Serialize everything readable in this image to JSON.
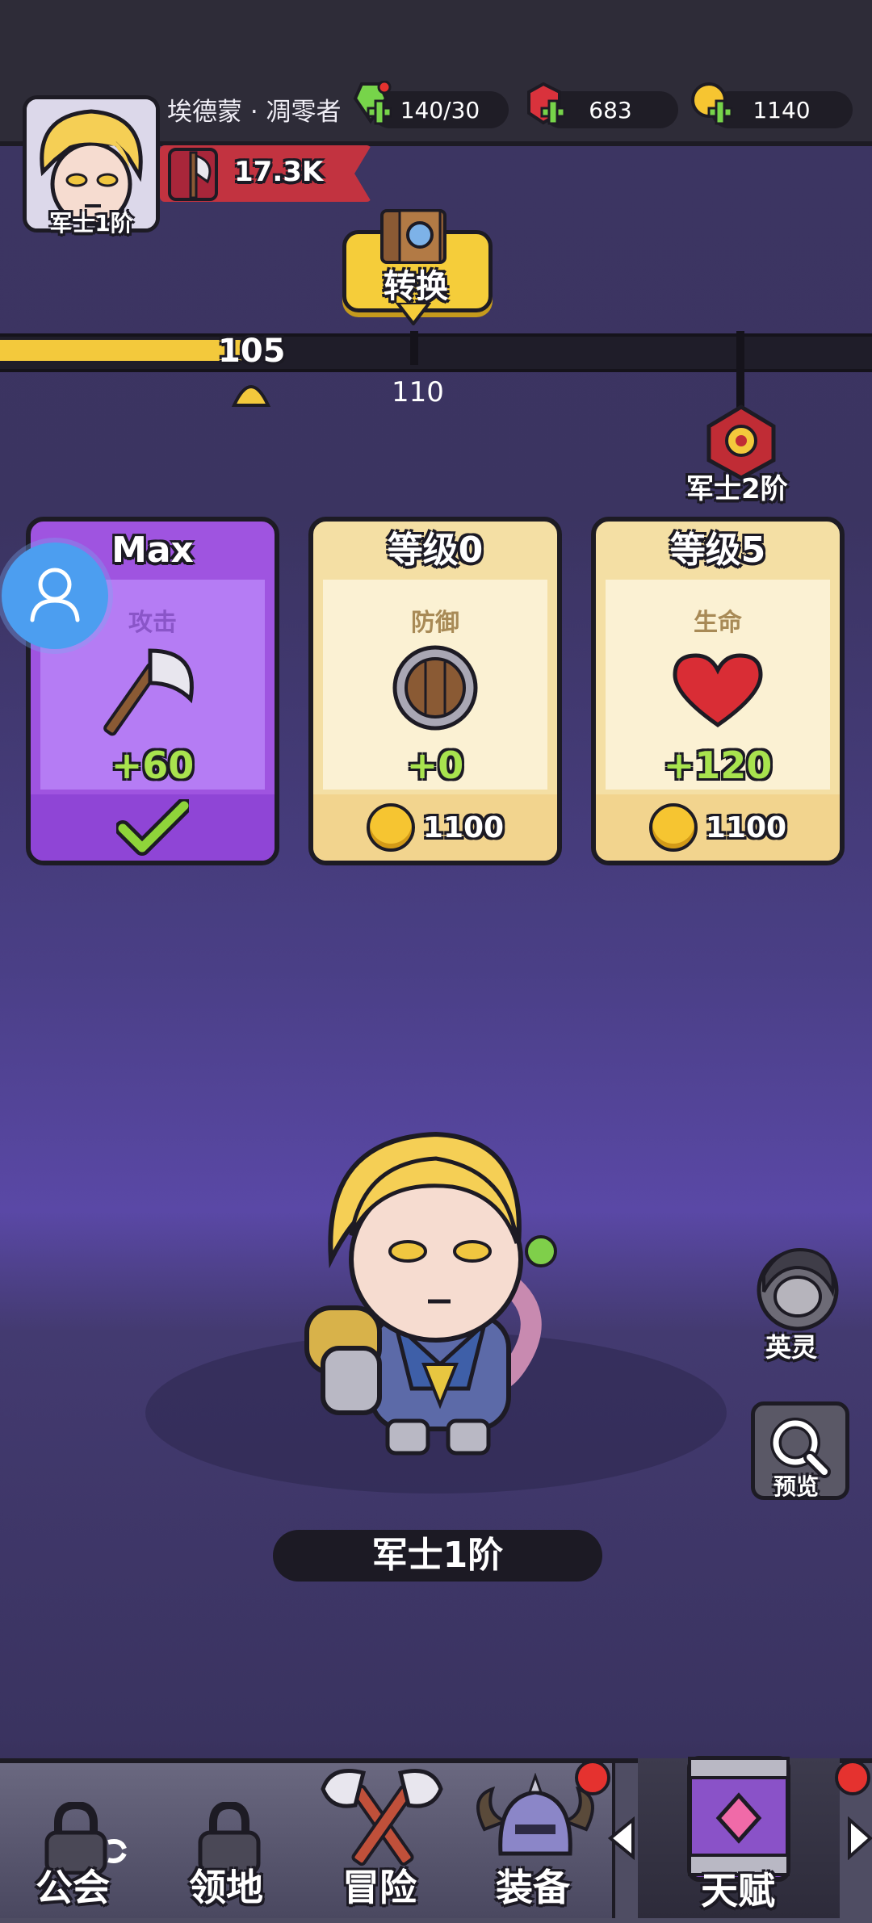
{
  "header": {
    "player_name": "埃德蒙 · 凋零者",
    "avatar_rank": "军士1阶",
    "power": "17.3K",
    "resources": {
      "energy": "140/30",
      "gems": "683",
      "gold": "1140"
    }
  },
  "convert_button": {
    "label": "转换"
  },
  "progress": {
    "current_level": "105",
    "next_marker": "110",
    "milestone_label": "军士2阶",
    "fill_fraction": 0.28
  },
  "cards": [
    {
      "level": "Max",
      "stat": "攻击",
      "bonus": "+60",
      "cost": ""
    },
    {
      "level": "等级0",
      "stat": "防御",
      "bonus": "+0",
      "cost": "1100"
    },
    {
      "level": "等级5",
      "stat": "生命",
      "bonus": "+120",
      "cost": "1100"
    }
  ],
  "hero": {
    "rank_label": "军士1阶"
  },
  "side_buttons": {
    "spirit": "英灵",
    "preview": "预览"
  },
  "nav": {
    "guild": "公会",
    "territory": "领地",
    "adventure": "冒险",
    "equipment": "装备",
    "talent": "天赋"
  },
  "colors": {
    "accent_yellow": "#f3c93c",
    "purple_card": "#a35ae6",
    "bonus_green": "#a8e34e",
    "banner_red": "#c23340",
    "notification_red": "#e5322f"
  }
}
